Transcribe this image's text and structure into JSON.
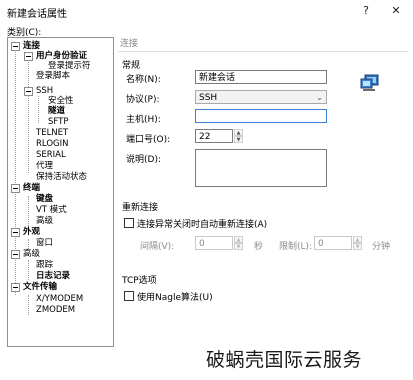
{
  "window": {
    "title": "新建会话属性",
    "help_glyph": "?",
    "close_glyph": "✕"
  },
  "sidebar": {
    "category_label": "类别(C):",
    "tree": {
      "n0": "连接",
      "n1": "用户身份验证",
      "n2": "登录提示符",
      "n3": "登录脚本",
      "n4": "SSH",
      "n5": "安全性",
      "n6": "隧道",
      "n7": "SFTP",
      "n8": "TELNET",
      "n9": "RLOGIN",
      "n10": "SERIAL",
      "n11": "代理",
      "n12": "保持活动状态",
      "n13": "终端",
      "n14": "键盘",
      "n15": "VT 模式",
      "n16": "高级",
      "n17": "外观",
      "n18": "窗口",
      "n19": "高级",
      "n20": "跟踪",
      "n21": "日志记录",
      "n22": "文件传输",
      "n23": "X/YMODEM",
      "n24": "ZMODEM"
    }
  },
  "panel": {
    "header": "连接",
    "general": {
      "title": "常规",
      "name_label": "名称(N):",
      "name_value": "新建会话",
      "protocol_label": "协议(P):",
      "protocol_value": "SSH",
      "host_label": "主机(H):",
      "host_value": "",
      "port_label": "端口号(O):",
      "port_value": "22",
      "desc_label": "说明(D):",
      "desc_value": ""
    },
    "reconnect": {
      "title": "重新连接",
      "auto_label": "连接异常关闭时自动重新连接(A)",
      "interval_label": "间隔(V):",
      "interval_value": "0",
      "interval_unit": "秒",
      "limit_label": "限制(L):",
      "limit_value": "0",
      "limit_unit": "分钟"
    },
    "tcp": {
      "title": "TCP选项",
      "nagle_label": "使用Nagle算法(U)"
    }
  },
  "watermark": "破蜗壳国际云服务"
}
